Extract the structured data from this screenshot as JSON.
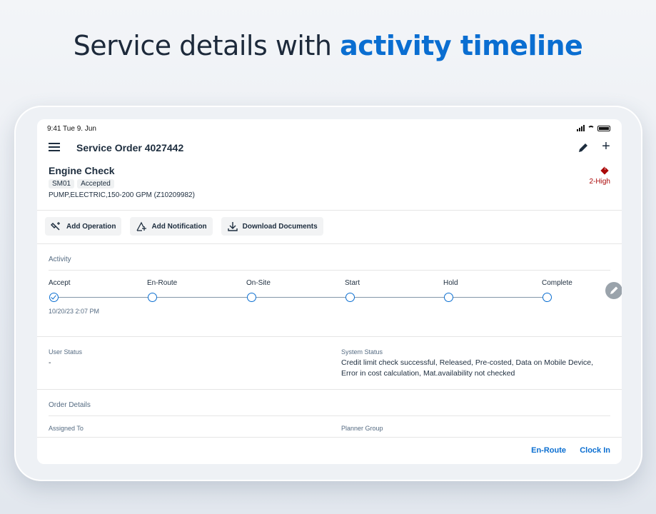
{
  "headline": {
    "prefix": "Service details with",
    "accent": "activity timeline"
  },
  "status_bar": {
    "time": "9:41  Tue 9. Jun"
  },
  "app_bar": {
    "title": "Service Order 4027442"
  },
  "order": {
    "title": "Engine Check",
    "tags": [
      "SM01",
      "Accepted"
    ],
    "subtitle": "PUMP,ELECTRIC,150-200 GPM (Z10209982)",
    "priority": "2-High"
  },
  "toolbar": {
    "add_operation": "Add Operation",
    "add_notification": "Add Notification",
    "download_documents": "Download Documents"
  },
  "activity": {
    "label": "Activity",
    "steps": [
      "Accept",
      "En-Route",
      "On-Site",
      "Start",
      "Hold",
      "Complete"
    ],
    "completed_step": "Accept",
    "accept_timestamp": "10/20/23 2:07 PM"
  },
  "status": {
    "user_status_label": "User Status",
    "user_status_value": "-",
    "system_status_label": "System Status",
    "system_status_line1": "Credit limit check successful, Released, Pre-costed, Data on Mobile Device,",
    "system_status_line2": "Error in cost calculation, Mat.availability not checked"
  },
  "order_details": {
    "label": "Order Details",
    "assigned_to_label": "Assigned To",
    "planner_group_label": "Planner Group"
  },
  "footer": {
    "en_route": "En-Route",
    "clock_in": "Clock In"
  },
  "colors": {
    "accent": "#0a6ed1",
    "priority_high": "#aa0808",
    "text": "#1d2d3e"
  }
}
